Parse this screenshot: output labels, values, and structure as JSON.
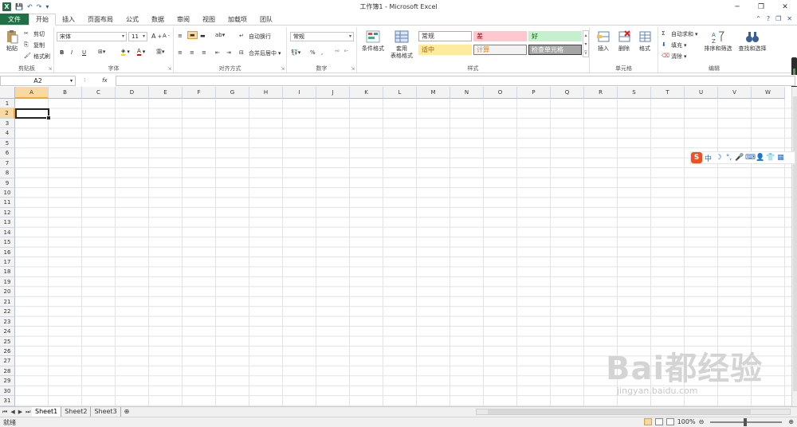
{
  "window": {
    "title": "工作簿1 - Microsoft Excel",
    "controls": [
      "─",
      "❐",
      "✕"
    ]
  },
  "quick_access": [
    "💾",
    "↶",
    "↷",
    "▾"
  ],
  "tabs": {
    "file": "文件",
    "items": [
      "开始",
      "插入",
      "页面布局",
      "公式",
      "数据",
      "审阅",
      "视图",
      "加载项",
      "团队"
    ],
    "active": "开始"
  },
  "ribbon": {
    "clipboard": {
      "label": "剪贴板",
      "paste": "粘贴",
      "cut": "剪切",
      "copy": "复制",
      "format_painter": "格式刷"
    },
    "font": {
      "label": "字体",
      "name": "宋体",
      "size": "11",
      "bold": "B",
      "italic": "I",
      "underline": "U"
    },
    "alignment": {
      "label": "对齐方式",
      "wrap": "自动换行",
      "merge": "合并后居中"
    },
    "number": {
      "label": "数字",
      "format": "常规",
      "percent": "%",
      "comma": ","
    },
    "styles": {
      "label": "样式",
      "conditional": "条件格式",
      "table_line1": "套用",
      "table_line2": "表格格式",
      "cells": [
        {
          "text": "常规",
          "bg": "#ffffff",
          "fg": "#333333",
          "border": "#e8a530"
        },
        {
          "text": "差",
          "bg": "#ffc7ce",
          "fg": "#9c0006",
          "border": "#ffc7ce"
        },
        {
          "text": "好",
          "bg": "#c6efce",
          "fg": "#006100",
          "border": "#c6efce"
        },
        {
          "text": "适中",
          "bg": "#ffeb9c",
          "fg": "#9c6500",
          "border": "#ffeb9c"
        },
        {
          "text": "计算",
          "bg": "#f2f2f2",
          "fg": "#fa7d00",
          "border": "#7f7f7f"
        },
        {
          "text": "检查单元格",
          "bg": "#a5a5a5",
          "fg": "#ffffff",
          "border": "#3f3f3f"
        }
      ]
    },
    "cells": {
      "label": "单元格",
      "insert": "插入",
      "delete": "删除",
      "format": "格式"
    },
    "editing": {
      "label": "编辑",
      "autosum": "自动求和",
      "fill": "填充",
      "clear": "清除",
      "sort": "排序和筛选",
      "find": "查找和选择"
    }
  },
  "formula_bar": {
    "name_box": "A2",
    "fx": "fx",
    "value": ""
  },
  "columns": [
    "A",
    "B",
    "C",
    "D",
    "E",
    "F",
    "G",
    "H",
    "I",
    "J",
    "K",
    "L",
    "M",
    "N",
    "O",
    "P",
    "Q",
    "R",
    "S",
    "T",
    "U",
    "V",
    "W"
  ],
  "selected_column": "A",
  "rows": [
    "1",
    "2",
    "3",
    "4",
    "5",
    "6",
    "7",
    "8",
    "9",
    "10",
    "11",
    "12",
    "13",
    "14",
    "15",
    "16",
    "17",
    "18",
    "19",
    "20",
    "21",
    "22",
    "23",
    "24",
    "25",
    "26",
    "27",
    "28",
    "29",
    "30",
    "31"
  ],
  "selected_row": "2",
  "sheets": [
    "Sheet1",
    "Sheet2",
    "Sheet3"
  ],
  "active_sheet": "Sheet1",
  "status": {
    "ready": "就绪",
    "zoom": "100%"
  },
  "ime_toolbar": [
    "S",
    "中",
    "☽",
    "°,",
    "🎤",
    "⌨",
    "👤",
    "👕",
    "▦"
  ],
  "watermark": {
    "main": "Bai都经验",
    "sub": "jingyan.baidu.com"
  }
}
